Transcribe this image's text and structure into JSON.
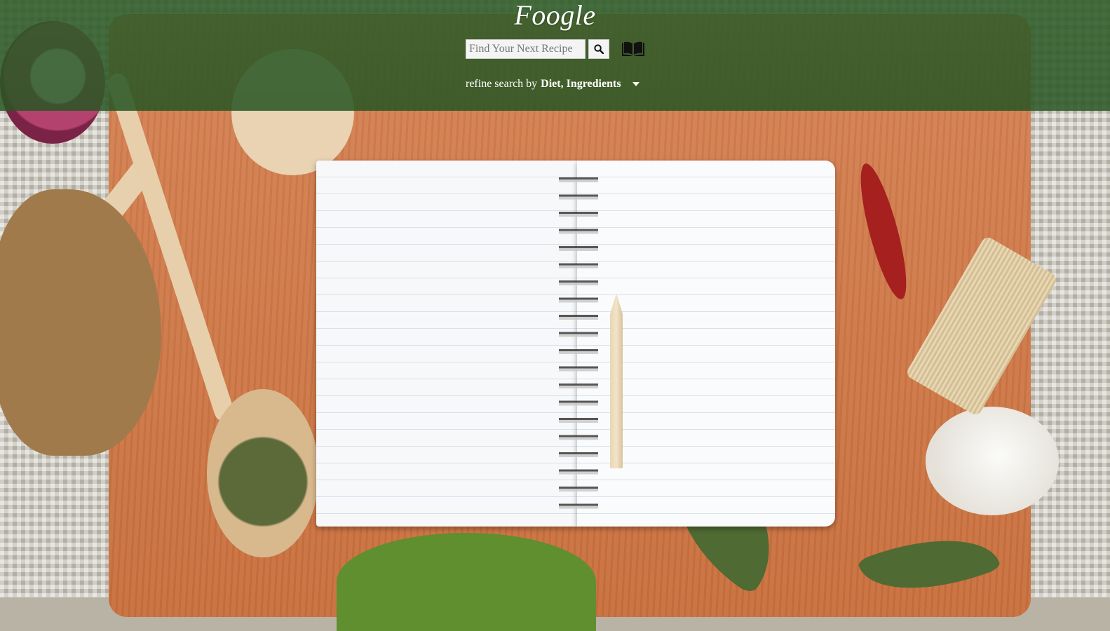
{
  "brand": {
    "logo": "Foogle"
  },
  "search": {
    "placeholder": "Find Your Next Recipe",
    "value": ""
  },
  "refine": {
    "prefix": "refine search by",
    "options": "Diet, Ingredients"
  },
  "colors": {
    "header": "#2f5c28",
    "board": "#d07b4c",
    "page": "#f7f8fa"
  },
  "icons": {
    "search": "search-icon",
    "book": "book-icon",
    "dropdown": "chevron-down-icon"
  }
}
